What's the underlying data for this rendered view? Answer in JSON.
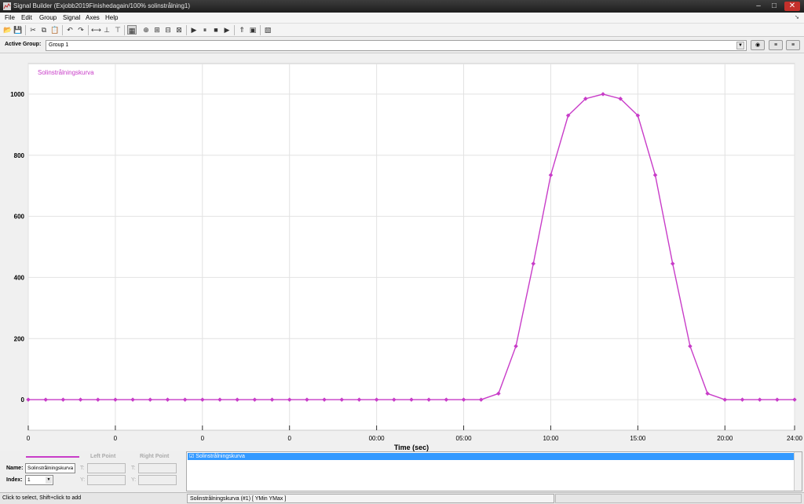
{
  "window": {
    "title": "Signal Builder (Exjobb2019Finishedagain/100% solinstrålning1)",
    "minimize": "–",
    "maximize": "□",
    "close": "✕"
  },
  "menu": [
    "File",
    "Edit",
    "Group",
    "Signal",
    "Axes",
    "Help"
  ],
  "toolbar_icons": [
    "open-icon",
    "save-icon",
    "cut-icon",
    "copy-icon",
    "paste-icon",
    "undo-icon",
    "redo-icon",
    "horizontal-segment-icon",
    "rise-icon",
    "fall-icon",
    "select-icon",
    "zoom-xy-icon",
    "zoom-x-icon",
    "zoom-y-icon",
    "fit-icon",
    "play-icon",
    "pause-icon",
    "stop-icon",
    "run-to-icon",
    "snap-icon",
    "help-icon",
    "plot-icon"
  ],
  "active_group": {
    "label": "Active Group:",
    "value": "Group 1"
  },
  "chart_data": {
    "type": "line",
    "series": [
      {
        "name": "Solinstrålningskurva",
        "color": "#c83cc8",
        "x": [
          0,
          1,
          2,
          3,
          4,
          5,
          6,
          7,
          8,
          9,
          10,
          11,
          12,
          13,
          14,
          15,
          16,
          17,
          18,
          19,
          20,
          21,
          22,
          23,
          24,
          25,
          26,
          27,
          28,
          29,
          30,
          31,
          32,
          33,
          34,
          35,
          36,
          37,
          38,
          39,
          40,
          41,
          42,
          43,
          44
        ],
        "y": [
          0,
          0,
          0,
          0,
          0,
          0,
          0,
          0,
          0,
          0,
          0,
          0,
          0,
          0,
          0,
          0,
          0,
          0,
          0,
          0,
          0,
          0,
          0,
          0,
          0,
          0,
          0,
          20,
          175,
          445,
          735,
          930,
          985,
          1000,
          985,
          930,
          735,
          445,
          175,
          20,
          0,
          0,
          0,
          0,
          0
        ]
      }
    ],
    "xlabel": "Time (sec)",
    "xticks": [
      {
        "x": 0,
        "label": "0"
      },
      {
        "x": 5,
        "label": "0"
      },
      {
        "x": 10,
        "label": "0"
      },
      {
        "x": 15,
        "label": "0"
      },
      {
        "x": 20,
        "label": "00:00"
      },
      {
        "x": 25,
        "label": "05:00"
      },
      {
        "x": 30,
        "label": "10:00"
      },
      {
        "x": 35,
        "label": "15:00"
      },
      {
        "x": 40,
        "label": "20:00"
      },
      {
        "x": 44,
        "label": "24:00"
      }
    ],
    "yticks": [
      0,
      200,
      400,
      600,
      800,
      1000
    ],
    "xlim": [
      0,
      44
    ],
    "ylim": [
      -100,
      1100
    ],
    "grid": true
  },
  "edit_panel": {
    "left_point": "Left Point",
    "right_point": "Right Point",
    "name_label": "Name:",
    "name_value": "Solinstrålningskurva",
    "index_label": "Index:",
    "index_value": "1",
    "t_label": "T:",
    "y_label": "Y:"
  },
  "signal_list": [
    {
      "label": "☑ Solinstrålningskurva",
      "selected": true
    }
  ],
  "status": {
    "hint": "Click to select, Shift+click to add",
    "signal": "Solinstrålningskurva (#1)  [ YMin YMax ]"
  }
}
